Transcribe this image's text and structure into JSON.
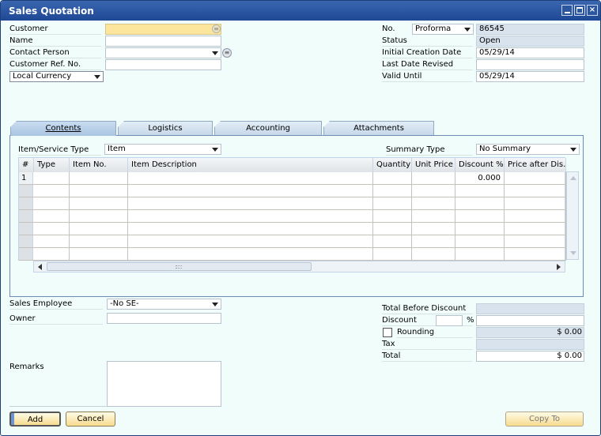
{
  "window": {
    "title": "Sales Quotation",
    "controls": {
      "minimize": "_",
      "maximize": "□",
      "close": "×"
    }
  },
  "header_left": {
    "customer": {
      "label": "Customer",
      "value": ""
    },
    "name": {
      "label": "Name",
      "value": ""
    },
    "contact_person": {
      "label": "Contact Person",
      "value": ""
    },
    "customer_ref": {
      "label": "Customer Ref. No.",
      "value": ""
    },
    "currency": {
      "value": "Local Currency"
    }
  },
  "header_right": {
    "no": {
      "label": "No.",
      "series": "Proforma",
      "value": "86545"
    },
    "status": {
      "label": "Status",
      "value": "Open"
    },
    "initial_creation_date": {
      "label": "Initial Creation Date",
      "value": "05/29/14"
    },
    "last_date_revised": {
      "label": "Last Date Revised",
      "value": ""
    },
    "valid_until": {
      "label": "Valid Until",
      "value": "05/29/14"
    }
  },
  "tabs": [
    {
      "label": "Contents",
      "active": true
    },
    {
      "label": "Logistics"
    },
    {
      "label": "Accounting"
    },
    {
      "label": "Attachments"
    }
  ],
  "contents": {
    "item_service_type": {
      "label": "Item/Service Type",
      "value": "Item"
    },
    "summary_type": {
      "label": "Summary Type",
      "value": "No Summary"
    },
    "columns": [
      "#",
      "Type",
      "Item No.",
      "Item Description",
      "Quantity",
      "Unit Price",
      "Discount %",
      "Price after Dis..."
    ],
    "rows": [
      {
        "num": "1",
        "discount": "0.000"
      },
      {
        "num": "",
        "discount": ""
      },
      {
        "num": "",
        "discount": ""
      },
      {
        "num": "",
        "discount": ""
      },
      {
        "num": "",
        "discount": ""
      },
      {
        "num": "",
        "discount": ""
      },
      {
        "num": "",
        "discount": ""
      }
    ]
  },
  "footer_left": {
    "sales_employee": {
      "label": "Sales Employee",
      "value": "-No SE-"
    },
    "owner": {
      "label": "Owner",
      "value": ""
    },
    "remarks": {
      "label": "Remarks",
      "value": ""
    }
  },
  "footer_right": {
    "total_before_discount": {
      "label": "Total Before Discount",
      "value": ""
    },
    "discount": {
      "label": "Discount",
      "percent": "",
      "percent_sign": "%",
      "value": ""
    },
    "rounding": {
      "label": "Rounding",
      "value": "$ 0.00",
      "checked": false
    },
    "tax": {
      "label": "Tax",
      "value": ""
    },
    "total": {
      "label": "Total",
      "value": "$ 0.00"
    }
  },
  "buttons": {
    "add": "Add",
    "cancel": "Cancel",
    "copy_to": "Copy To"
  }
}
